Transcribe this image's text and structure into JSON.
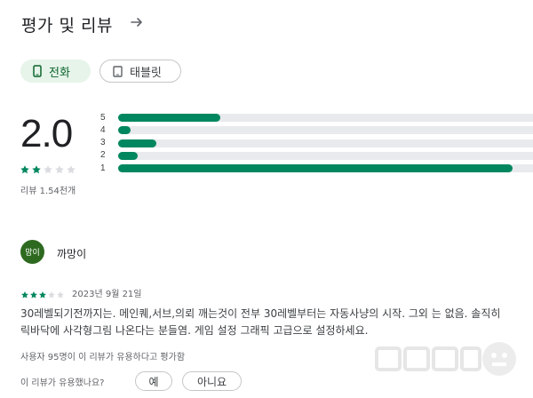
{
  "header": {
    "title": "평가 및 리뷰",
    "arrow_icon": "arrow-right-icon"
  },
  "device_tabs": [
    {
      "label": "전화",
      "icon": "phone-icon",
      "selected": true
    },
    {
      "label": "태블릿",
      "icon": "tablet-icon",
      "selected": false
    }
  ],
  "rating": {
    "score": "2.0",
    "stars": 2,
    "max_stars": 5,
    "review_count": "리뷰 1.54천개",
    "distribution": [
      {
        "label": "5",
        "fraction": 0.24
      },
      {
        "label": "4",
        "fraction": 0.03
      },
      {
        "label": "3",
        "fraction": 0.09
      },
      {
        "label": "2",
        "fraction": 0.045
      },
      {
        "label": "1",
        "fraction": 0.925
      }
    ]
  },
  "review": {
    "avatar_text": "망이",
    "username": "까망이",
    "stars": 3,
    "date": "2023년 9월 21일",
    "text_line1": "30레벨되기전까지는. 메인퀘,서브,의뢰 깨는것이 전부 30레벨부터는 자동사냥의 시작. 그외 는 없음. 솔직히",
    "text_line2": "릭바닥에 사각형그림 나온다는 분들염. 게임 설정 그래픽 고급으로 설정하세요.",
    "helpful_count": "사용자 95명이 이 리뷰가 유용하다고 평가함",
    "helpful_question": "이 리뷰가 유용했나요?",
    "yes_label": "예",
    "no_label": "아니요"
  },
  "colors": {
    "accent": "#01875f",
    "track": "#e8eaed",
    "chip_bg": "#e6f4ea",
    "avatar_bg": "#2d6a1f"
  }
}
